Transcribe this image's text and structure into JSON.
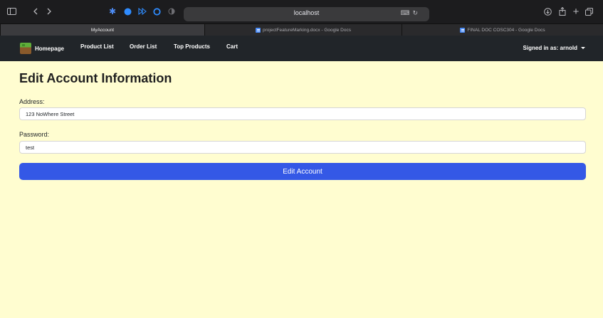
{
  "browser": {
    "url": "localhost",
    "tabs": [
      {
        "label": "MyAccount",
        "active": true
      },
      {
        "label": "projectFeatureMarking.docx - Google Docs",
        "active": false
      },
      {
        "label": "FINAL DOC COSC304 - Google Docs",
        "active": false
      }
    ],
    "icons": [
      "sidebar-icon",
      "back-icon",
      "forward-icon",
      "extension-icons",
      "translate-icon",
      "reload-icon",
      "download-icon",
      "share-icon",
      "new-tab-icon",
      "tab-overview-icon"
    ]
  },
  "nav": {
    "brand": "Homepage",
    "links": [
      "Product List",
      "Order List",
      "Top Products",
      "Cart"
    ],
    "signed_in": "Signed in as: arnold"
  },
  "form": {
    "title": "Edit Account Information",
    "address_label": "Address:",
    "address_value": "123 NoWhere Street",
    "password_label": "Password:",
    "password_value": "test",
    "submit_label": "Edit Account"
  },
  "colors": {
    "page_bg": "#fffdd0",
    "navbar_bg": "#212529",
    "button_bg": "#3458e6"
  }
}
